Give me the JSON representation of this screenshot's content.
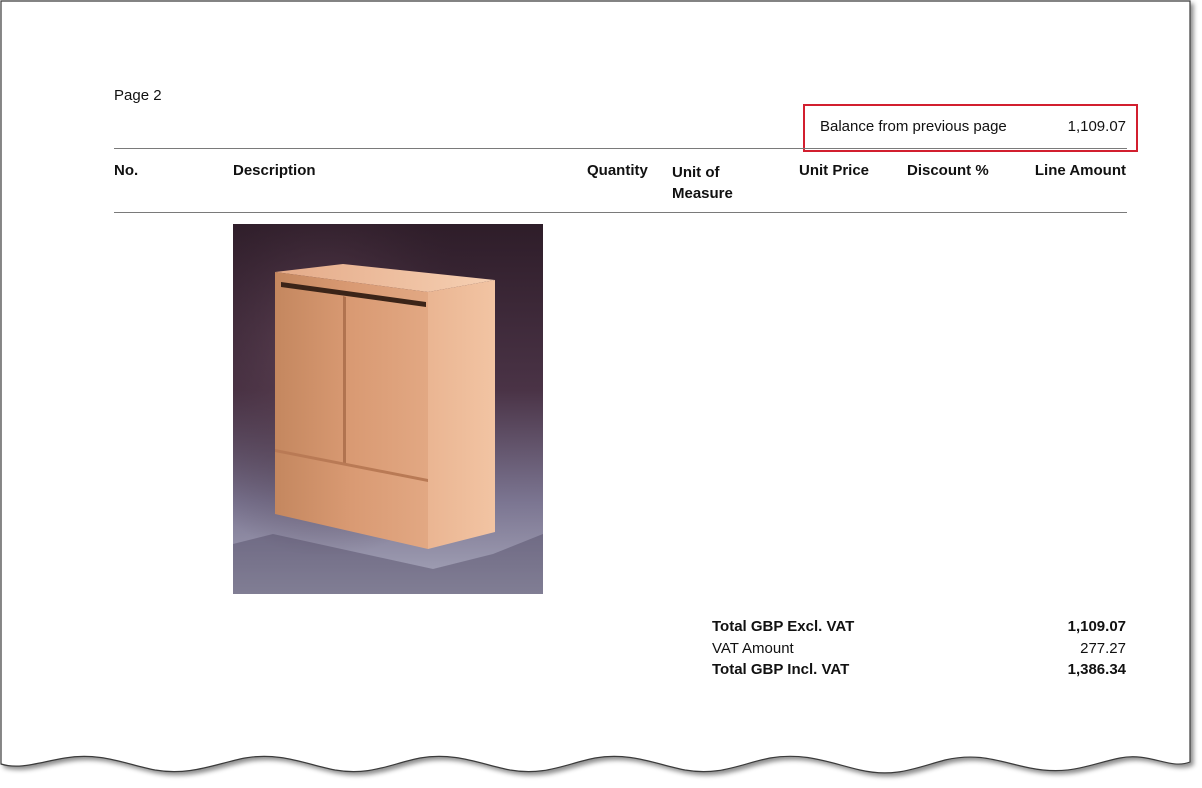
{
  "page": {
    "label": "Page 2"
  },
  "balance": {
    "label": "Balance from previous page",
    "value": "1,109.07"
  },
  "table": {
    "columns": {
      "no": "No.",
      "description": "Description",
      "quantity": "Quantity",
      "unit_of_measure_line1": "Unit of",
      "unit_of_measure_line2": "Measure",
      "unit_price": "Unit Price",
      "discount": "Discount %",
      "line_amount": "Line Amount"
    }
  },
  "product_image": {
    "subject": "wooden two-door cabinet"
  },
  "totals": {
    "excl_vat_label": "Total GBP Excl. VAT",
    "excl_vat_value": "1,109.07",
    "vat_label": "VAT Amount",
    "vat_value": "277.27",
    "incl_vat_label": "Total GBP Incl. VAT",
    "incl_vat_value": "1,386.34"
  },
  "colors": {
    "highlight": "#d21f2f",
    "rule": "#7a7a7a"
  }
}
